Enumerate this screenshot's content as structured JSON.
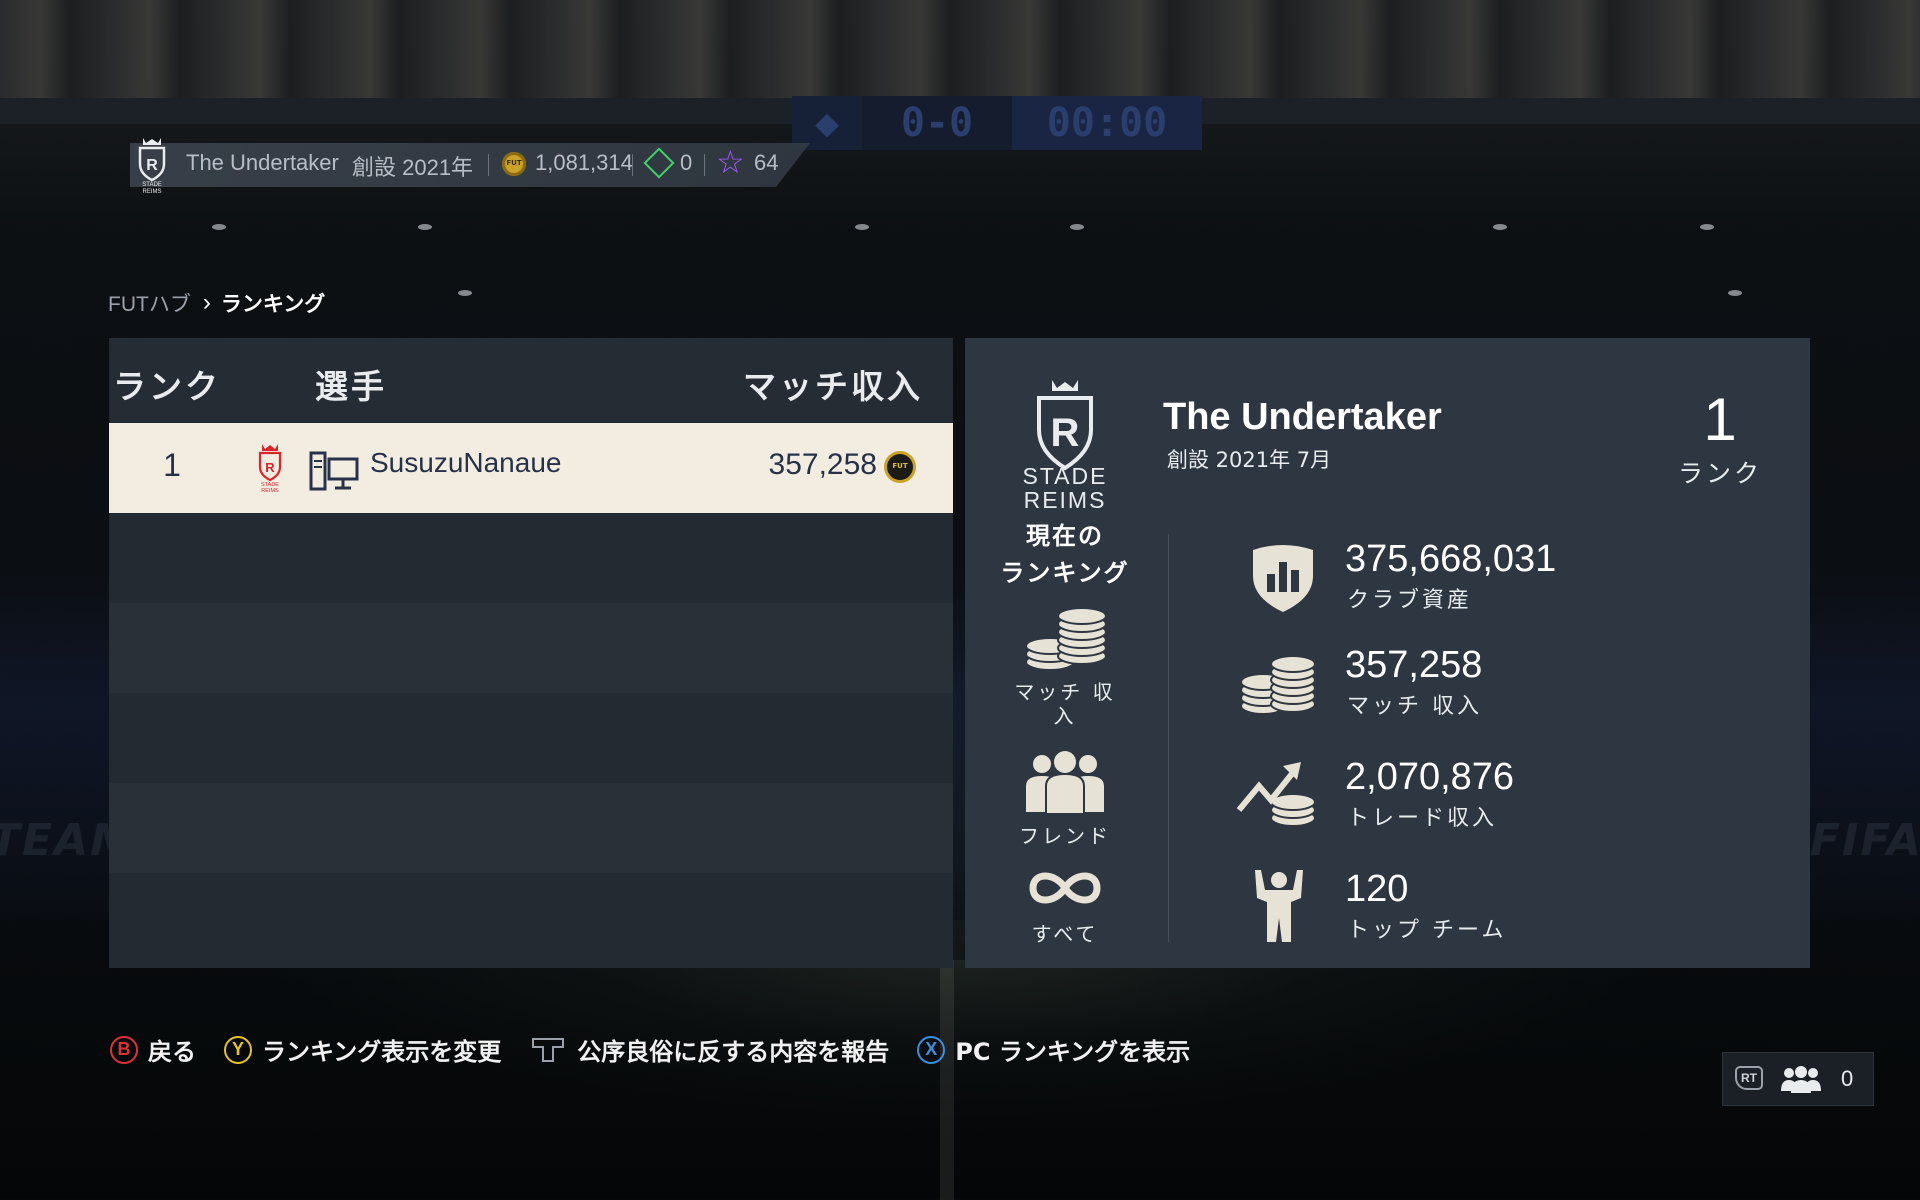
{
  "header": {
    "club_name": "The Undertaker",
    "founded": "創設 2021年",
    "coins": "1,081,314",
    "ea_points": "0",
    "fut_champs_points": "64"
  },
  "breadcrumb": {
    "root": "FUTハブ",
    "current": "ランキング"
  },
  "table": {
    "columns": {
      "rank": "ランク",
      "player": "選手",
      "earnings": "マッチ収入"
    },
    "rows": [
      {
        "rank": "1",
        "player": "SusuzuNanaue",
        "earnings": "357,258",
        "platform_icon": "pc-console-icon"
      }
    ]
  },
  "detail": {
    "crest_text_line1": "STADE",
    "crest_text_line2": "REIMS",
    "club_name": "The Undertaker",
    "founded": "創設 2021年 7月",
    "rank_value": "1",
    "rank_label": "ランク",
    "categories_title": "現在の\nランキング",
    "categories": [
      {
        "label": "マッチ 収入",
        "icon": "coins-stack-icon"
      },
      {
        "label": "フレンド",
        "icon": "friends-icon"
      },
      {
        "label": "すべて",
        "icon": "infinity-icon"
      }
    ],
    "stats": [
      {
        "value": "375,668,031",
        "label": "クラブ資産",
        "icon": "club-value-shield-icon"
      },
      {
        "value": "357,258",
        "label": "マッチ 収入",
        "icon": "coins-icon"
      },
      {
        "value": "2,070,876",
        "label": "トレード収入",
        "icon": "trade-earnings-icon"
      },
      {
        "value": "120",
        "label": "トップ チーム",
        "icon": "top-team-player-icon"
      }
    ]
  },
  "footer": {
    "back": "戻る",
    "change_view": "ランキング表示を変更",
    "report": "公序良俗に反する内容を報告",
    "pc_ranking": "PC ランキングを表示"
  },
  "friends_online": {
    "trigger": "RT",
    "count": "0"
  },
  "colors": {
    "selected_row": "#f3ede1",
    "panel": "#242a31",
    "detail_panel": "#2e3741",
    "accent_gold": "#c9a227"
  }
}
